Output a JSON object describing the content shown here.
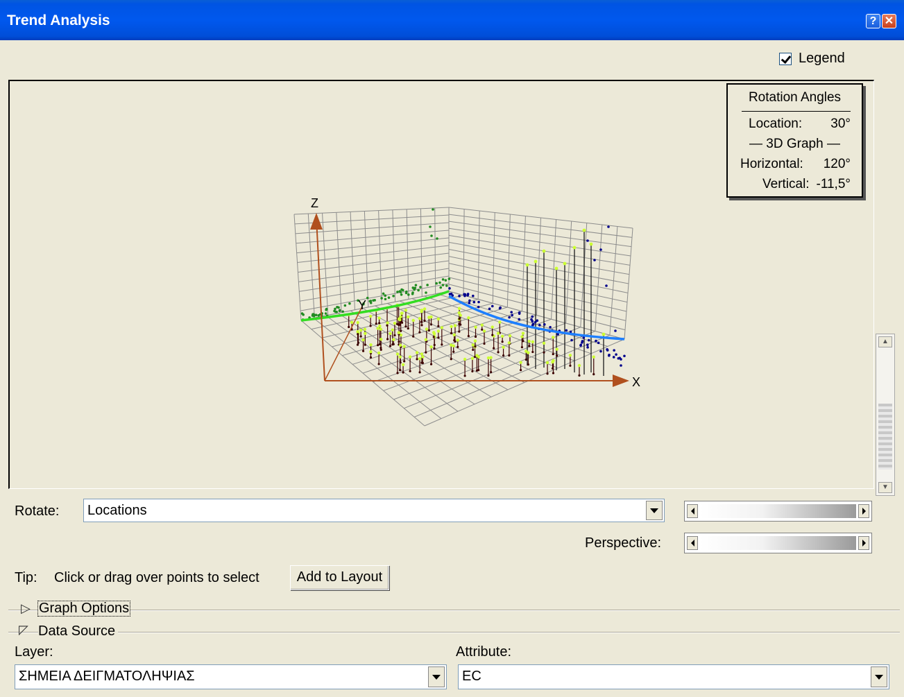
{
  "window": {
    "title": "Trend Analysis",
    "help_label": "?",
    "close_label": "✕"
  },
  "legend": {
    "label": "Legend",
    "checked": true
  },
  "rotation_angles": {
    "title": "Rotation Angles",
    "location_label": "Location:",
    "location_value": "30°",
    "section_3d": "— 3D Graph —",
    "horizontal_label": "Horizontal:",
    "horizontal_value": "120°",
    "vertical_label": "Vertical:",
    "vertical_value": "-11,5°"
  },
  "graph": {
    "axis_x": "X",
    "axis_y": "Y",
    "axis_z": "Z",
    "colors": {
      "grid": "#8c8c8c",
      "axis": "#b0501e",
      "trend_xz": "#33dd22",
      "trend_yz": "#1e7fff",
      "points_green": "#228b22",
      "points_blue": "#00008b",
      "points_yellow": "#ccff33",
      "stems": "#3a0000"
    }
  },
  "controls": {
    "rotate_label": "Rotate:",
    "rotate_value": "Locations",
    "perspective_label": "Perspective:",
    "tip_label": "Tip:",
    "tip_text": "Click or drag over points to select",
    "add_to_layout": "Add to Layout"
  },
  "sections": {
    "graph_options": "Graph Options",
    "data_source": "Data Source"
  },
  "data_source": {
    "layer_label": "Layer:",
    "layer_value": "ΣΗΜΕΙΑ ΔΕΙΓΜΑΤΟΛΗΨΙΑΣ",
    "attribute_label": "Attribute:",
    "attribute_value": "EC"
  }
}
